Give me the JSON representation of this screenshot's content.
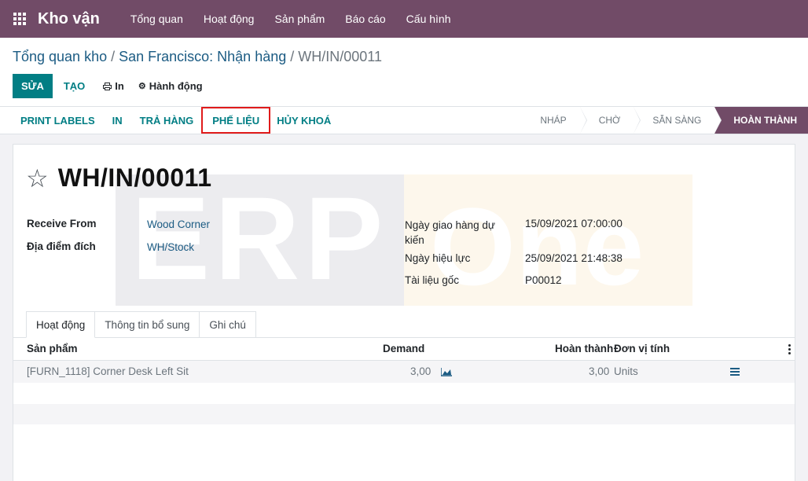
{
  "topbar": {
    "app_name": "Kho vận",
    "menu": [
      "Tổng quan",
      "Hoạt động",
      "Sản phẩm",
      "Báo cáo",
      "Cấu hình"
    ]
  },
  "breadcrumb": {
    "items": [
      "Tổng quan kho",
      "San Francisco: Nhận hàng"
    ],
    "separator": "/",
    "active": "WH/IN/00011"
  },
  "buttons": {
    "edit": "SỬA",
    "create": "TẠO",
    "print": "In",
    "action": "Hành động"
  },
  "header_buttons": [
    "PRINT LABELS",
    "IN",
    "TRẢ HÀNG",
    "PHẾ LIỆU",
    "HỦY KHOÁ"
  ],
  "stages": [
    "NHÁP",
    "CHỜ",
    "SẴN SÀNG",
    "HOÀN THÀNH"
  ],
  "record": {
    "title": "WH/IN/00011",
    "receive_from_label": "Receive From",
    "receive_from": "Wood Corner",
    "destination_label": "Địa điểm đích",
    "destination": "WH/Stock",
    "scheduled_label": "Ngày giao hàng dự kiến",
    "scheduled": "15/09/2021 07:00:00",
    "effective_label": "Ngày hiệu lực",
    "effective": "25/09/2021 21:48:38",
    "origin_label": "Tài liệu gốc",
    "origin": "P00012"
  },
  "watermark": {
    "left": "ERP",
    "right": "One"
  },
  "tabs": [
    "Hoạt động",
    "Thông tin bổ sung",
    "Ghi chú"
  ],
  "table": {
    "headers": {
      "product": "Sản phẩm",
      "demand": "Demand",
      "done": "Hoàn thành",
      "uom": "Đơn vị tính"
    },
    "rows": [
      {
        "product": "[FURN_1118] Corner Desk Left Sit",
        "demand": "3,00",
        "done": "3,00",
        "uom": "Units"
      }
    ]
  },
  "colors": {
    "brand": "#714b67",
    "accent": "#017e84",
    "highlight": "#e01b1b"
  }
}
